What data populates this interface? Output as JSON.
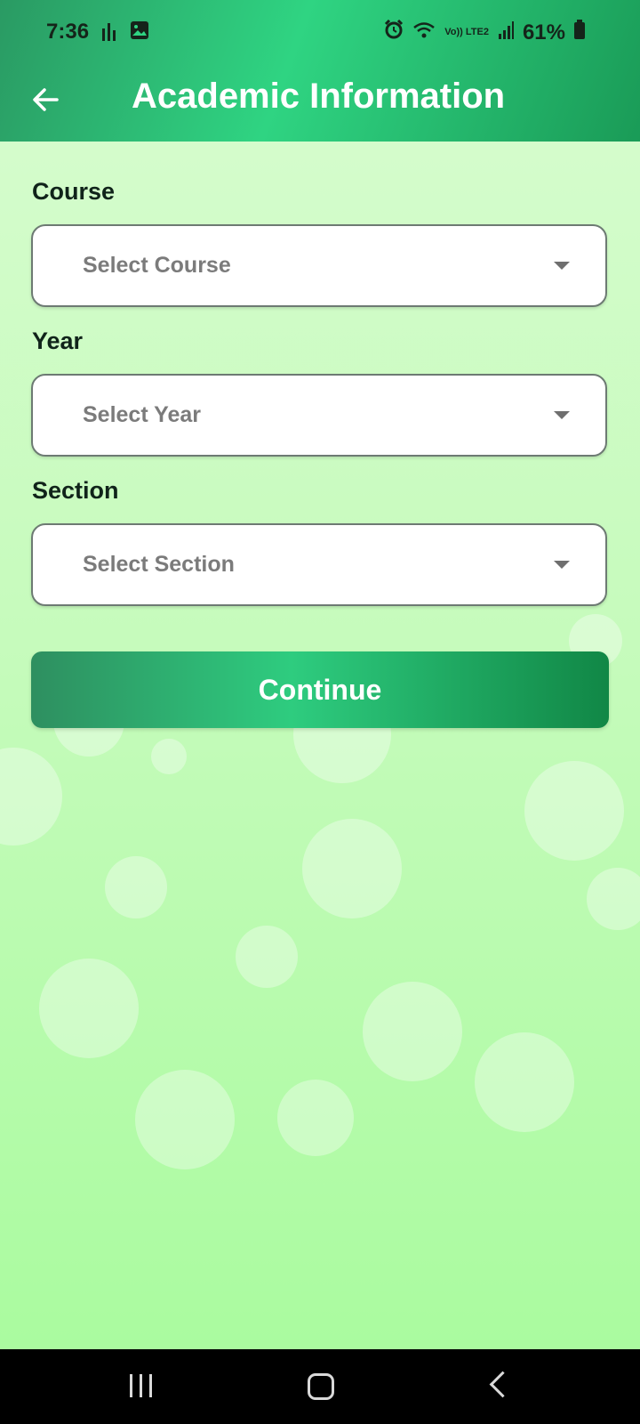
{
  "status_bar": {
    "time": "7:36",
    "battery": "61%",
    "icons_left": [
      "signal-bars-icon",
      "image-icon"
    ],
    "icons_right": [
      "alarm-icon",
      "wifi-icon",
      "volte-icon",
      "cell-signal-icon",
      "battery-icon"
    ],
    "network_label": "Vo)) LTE2"
  },
  "app_bar": {
    "title": "Academic Information",
    "back_icon": "arrow-left-icon"
  },
  "form": {
    "course": {
      "label": "Course",
      "placeholder": "Select Course"
    },
    "year": {
      "label": "Year",
      "placeholder": "Select Year"
    },
    "section": {
      "label": "Section",
      "placeholder": "Select Section"
    },
    "continue_label": "Continue"
  },
  "colors": {
    "accent": "#2ecc7f",
    "accent_dark": "#118746",
    "background_top": "#d8fcd0",
    "background_bottom": "#a7fb9c"
  },
  "nav_bar": {
    "icons": [
      "recent-apps-icon",
      "home-icon",
      "back-icon"
    ]
  }
}
